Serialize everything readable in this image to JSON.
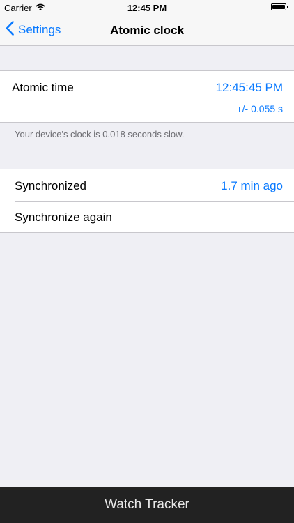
{
  "status_bar": {
    "carrier": "Carrier",
    "time": "12:45 PM",
    "battery_level": 1.0
  },
  "nav": {
    "back_label": "Settings",
    "title": "Atomic clock"
  },
  "atomic": {
    "label": "Atomic time",
    "time_value": "12:45:45 PM",
    "accuracy": "+/- 0.055 s"
  },
  "note": {
    "text": "Your device's clock is 0.018 seconds slow."
  },
  "sync": {
    "synchronized_label": "Synchronized",
    "synchronized_value": "1.7 min ago",
    "again_label": "Synchronize again"
  },
  "footer": {
    "label": "Watch Tracker"
  },
  "colors": {
    "accent": "#0a7aff",
    "background": "#efeff4",
    "footer_bg": "#222222"
  }
}
